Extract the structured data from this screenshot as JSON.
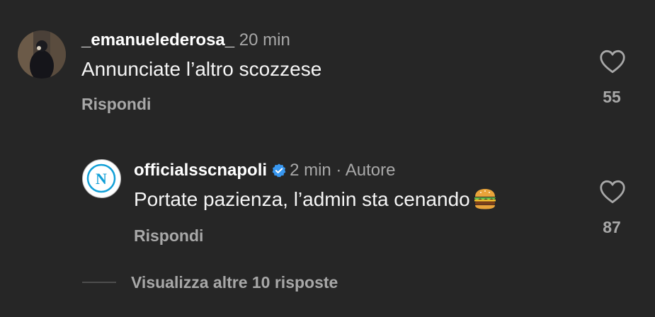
{
  "comments": [
    {
      "username": "_emanuelederosa_",
      "time": "20 min",
      "text": "Annunciate l’altro scozzese",
      "reply_label": "Rispondi",
      "likes": "55",
      "avatar_icon": "profile-photo",
      "like_icon": "heart-outline-icon"
    },
    {
      "username": "officialsscnapoli",
      "verified_icon": "verified-badge-icon",
      "time": "2 min",
      "author_label": "· Autore",
      "text": "Portate pazienza, l’admin sta cenando",
      "emoji": "hamburger-emoji",
      "reply_label": "Rispondi",
      "likes": "87",
      "avatar_icon": "ssc-napoli-logo",
      "logo_text": "N",
      "like_icon": "heart-outline-icon"
    }
  ],
  "view_more_replies": "Visualizza altre 10 risposte",
  "colors": {
    "background": "#262626",
    "primary_text": "#f5f5f5",
    "secondary_text": "#a8a8a8",
    "verified_blue": "#3897f0",
    "napoli_blue": "#12a0d7"
  }
}
